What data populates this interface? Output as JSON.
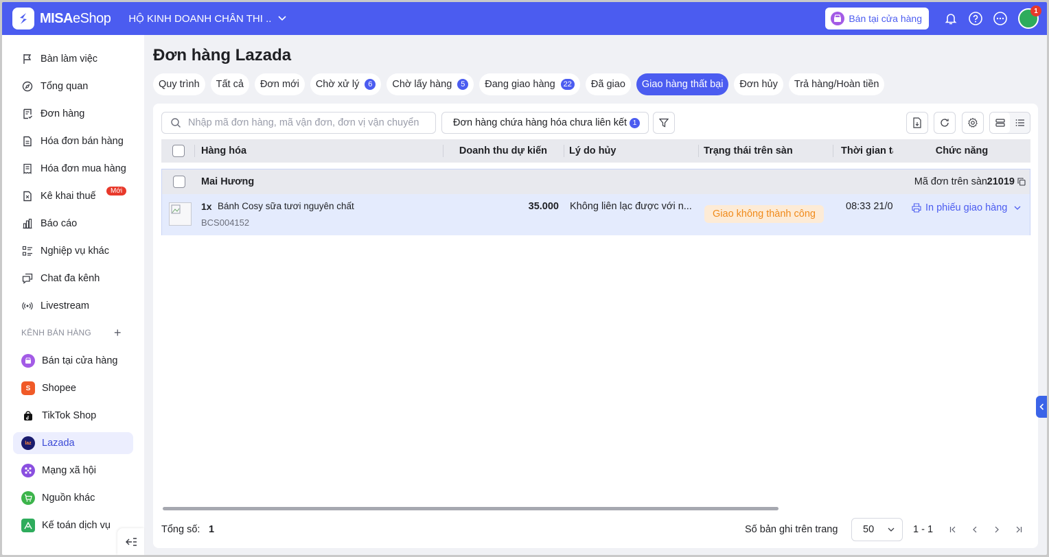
{
  "topbar": {
    "logo_bold": "MISA",
    "logo_light": "eShop",
    "store_name": "HỘ KINH DOANH CHÂN THI ..",
    "pos_button": "Bán tại cửa hàng",
    "avatar_badge": "1",
    "brand_color": "#4b5cf0"
  },
  "sidebar": {
    "items": [
      {
        "label": "Bàn làm việc",
        "icon": "flag-icon"
      },
      {
        "label": "Tổng quan",
        "icon": "compass-icon"
      },
      {
        "label": "Đơn hàng",
        "icon": "order-icon"
      },
      {
        "label": "Hóa đơn bán hàng",
        "icon": "invoice-icon"
      },
      {
        "label": "Hóa đơn mua hàng",
        "icon": "receipt-icon"
      },
      {
        "label": "Kê khai thuế",
        "icon": "tax-icon",
        "badge": "Mới"
      },
      {
        "label": "Báo cáo",
        "icon": "chart-icon"
      },
      {
        "label": "Nghiệp vụ khác",
        "icon": "list-icon"
      },
      {
        "label": "Chat đa kênh",
        "icon": "chat-icon"
      },
      {
        "label": "Livestream",
        "icon": "broadcast-icon"
      }
    ],
    "section_title": "KÊNH BÁN HÀNG",
    "channels": [
      {
        "label": "Bán tại cửa hàng",
        "color": "#a35be6"
      },
      {
        "label": "Shopee",
        "color": "#f05a28"
      },
      {
        "label": "TikTok Shop",
        "color": "#111111"
      },
      {
        "label": "Lazada",
        "color": "#1a1c6e",
        "active": true
      },
      {
        "label": "Mạng xã hội",
        "color": "#8a4fe0"
      },
      {
        "label": "Nguồn khác",
        "color": "#3cb44b"
      },
      {
        "label": "Kế toán dịch vụ",
        "color": "#2eac5c"
      }
    ]
  },
  "main": {
    "title": "Đơn hàng Lazada",
    "tabs": [
      {
        "label": "Quy trình"
      },
      {
        "label": "Tất cả"
      },
      {
        "label": "Đơn mới"
      },
      {
        "label": "Chờ xử lý",
        "count": "6"
      },
      {
        "label": "Chờ lấy hàng",
        "count": "5"
      },
      {
        "label": "Đang giao hàng",
        "count": "22"
      },
      {
        "label": "Đã giao"
      },
      {
        "label": "Giao hàng thất bại",
        "active": true
      },
      {
        "label": "Đơn hủy"
      },
      {
        "label": "Trả hàng/Hoàn tiền"
      }
    ],
    "search_placeholder": "Nhập mã đơn hàng, mã vận đơn, đơn vị vận chuyển",
    "unlinked_label": "Đơn hàng chứa hàng hóa chưa liên kết",
    "unlinked_count": "1",
    "columns": [
      "Hàng hóa",
      "Doanh thu dự kiến",
      "Lý do hủy",
      "Trạng thái trên sàn",
      "Thời gian tạ",
      "Chức năng"
    ],
    "order": {
      "customer": "Mai Hương",
      "order_code_label": "Mã đơn trên sàn:",
      "order_code": "21019",
      "qty": "1x",
      "product_name": "Bánh Cosy sữa tươi nguyên chất",
      "sku": "BCS004152",
      "revenue": "35.000",
      "cancel_reason": "Không liên lạc được với n...",
      "status": "Giao không thành công",
      "time": "08:33 21/0",
      "action": "In phiếu giao hàng"
    },
    "footer": {
      "total_label": "Tổng số:",
      "total": "1",
      "per_page_label": "Số bản ghi trên trang",
      "per_page": "50",
      "range": "1 - 1"
    }
  }
}
